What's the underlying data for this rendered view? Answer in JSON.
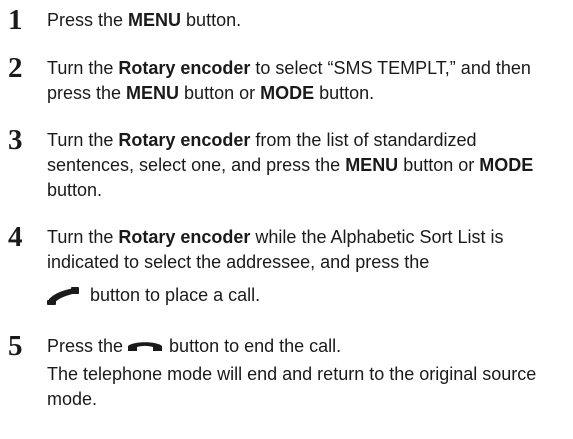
{
  "steps": [
    {
      "number": "1",
      "t1": "Press the ",
      "b1": "MENU",
      "t2": " button."
    },
    {
      "number": "2",
      "t1": "Turn the ",
      "b1": "Rotary encoder",
      "t2": " to select “SMS TEMPLT,” and then press the ",
      "b2": "MENU",
      "t3": " button or ",
      "b3": "MODE",
      "t4": " button."
    },
    {
      "number": "3",
      "t1": "Turn the ",
      "b1": "Rotary encoder",
      "t2": " from the list of standardized sentences, select one, and press the ",
      "b2": "MENU",
      "t3": " button or ",
      "b3": "MODE",
      "t4": " button."
    },
    {
      "number": "4",
      "t1": "Turn the ",
      "b1": "Rotary encoder",
      "t2": " while the Alphabetic Sort List is indicated to select the addressee, and press the",
      "icon": "phone-send-icon",
      "t3": " button to place a call."
    },
    {
      "number": "5",
      "t1": "Press the",
      "icon": "phone-end-icon",
      "t2": "button to end the call.",
      "t3": "The telephone mode will end and return to the original source mode."
    }
  ]
}
